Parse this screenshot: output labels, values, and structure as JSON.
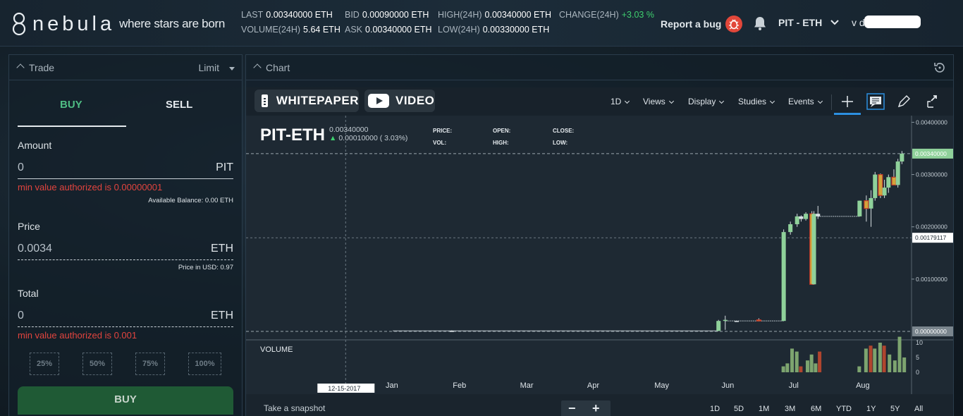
{
  "header": {
    "logo_name": "nebula",
    "logo_tagline": "where stars are born",
    "stats": {
      "last_label": "LAST",
      "last_value": "0.00340000 ETH",
      "bid_label": "BID",
      "bid_value": "0.00090000 ETH",
      "high_label": "HIGH(24H)",
      "high_value": "0.00340000 ETH",
      "change_label": "CHANGE(24H)",
      "change_value": "+3.03 %",
      "volume_label": "VOLUME(24H)",
      "volume_value": "5.64 ETH",
      "ask_label": "ASK",
      "ask_value": "0.00340000 ETH",
      "low_label": "LOW(24H)",
      "low_value": "0.00330000 ETH"
    },
    "report_bug_label": "Report a bug",
    "pair": "PIT - ETH",
    "user_email": "v           da@gma"
  },
  "trade": {
    "title": "Trade",
    "order_type": "Limit",
    "buy_tab": "BUY",
    "sell_tab": "SELL",
    "amount_label": "Amount",
    "amount_value": "0",
    "amount_unit": "PIT",
    "amount_error": "min value authorized is 0.00000001",
    "available_balance": "Available Balance: 0.00 ETH",
    "price_label": "Price",
    "price_value": "0.0034",
    "price_unit": "ETH",
    "price_usd": "Price in USD: 0.97",
    "total_label": "Total",
    "total_value": "0",
    "total_unit": "ETH",
    "total_error": "min value authorized is 0.001",
    "percent_buttons": [
      "25%",
      "50%",
      "75%",
      "100%"
    ],
    "buy_button": "BUY"
  },
  "chart": {
    "title": "Chart",
    "whitepaper": "WHITEPAPER",
    "video": "VIDEO",
    "toolbar": [
      "1D",
      "Views",
      "Display",
      "Studies",
      "Events"
    ],
    "pair": "PIT-ETH",
    "last_price": "0.00340000",
    "change": "0.00010000 ( 3.03%)",
    "ohlc_labels": [
      "PRICE:",
      "OPEN:",
      "CLOSE:",
      "VOL:",
      "HIGH:",
      "LOW:"
    ],
    "volume_label": "VOLUME",
    "snapshot_label": "Take a snapshot",
    "zoom_out": "−",
    "zoom_in": "+",
    "ranges": [
      "1D",
      "5D",
      "1M",
      "3M",
      "6M",
      "YTD",
      "1Y",
      "5Y",
      "All"
    ],
    "crosshair_date": "12-15-2017",
    "crosshair_price": "0.00179117",
    "current_price_tag": "0.00340000",
    "zero_price_tag": "0.00000000"
  },
  "chart_data": {
    "type": "candlestick",
    "x_axis_labels": [
      "Jan",
      "Feb",
      "Mar",
      "Apr",
      "May",
      "Jun",
      "Jul",
      "Aug"
    ],
    "price_axis": {
      "ticks": [
        "0.00400000",
        "0.00300000",
        "0.00200000",
        "0.00100000"
      ],
      "ylim": [
        0,
        0.0041
      ]
    },
    "volume_axis": {
      "ticks": [
        "10",
        "5",
        "0"
      ],
      "ylim": [
        0,
        10
      ]
    },
    "colors": {
      "up": "#8fd19a",
      "down": "#c0392b",
      "down_fill": "#d4a43a"
    },
    "candles": [
      {
        "t": 0.88,
        "o": 1e-05,
        "h": 2e-05,
        "l": 0.0,
        "c": 1e-05,
        "dir": "flat"
      },
      {
        "t": 4.85,
        "o": 1e-05,
        "h": 0.00022,
        "l": 1e-05,
        "c": 0.0002,
        "dir": "up"
      },
      {
        "t": 4.95,
        "o": 0.0002,
        "h": 0.0003,
        "l": 3e-05,
        "c": 0.00022,
        "dir": "up"
      },
      {
        "t": 5.12,
        "o": 0.0002,
        "h": 0.0002,
        "l": 0.0002,
        "c": 0.0002,
        "dir": "flat"
      },
      {
        "t": 5.45,
        "o": 0.00022,
        "h": 0.00025,
        "l": 0.00019,
        "c": 0.0002,
        "dir": "down"
      },
      {
        "t": 5.82,
        "o": 0.0002,
        "h": 0.00195,
        "l": 0.0002,
        "c": 0.0019,
        "dir": "up"
      },
      {
        "t": 5.92,
        "o": 0.0019,
        "h": 0.0021,
        "l": 0.00185,
        "c": 0.00205,
        "dir": "up"
      },
      {
        "t": 6.02,
        "o": 0.00205,
        "h": 0.00225,
        "l": 0.002,
        "c": 0.0022,
        "dir": "up"
      },
      {
        "t": 6.08,
        "o": 0.0022,
        "h": 0.00222,
        "l": 0.0021,
        "c": 0.00215,
        "dir": "flat"
      },
      {
        "t": 6.15,
        "o": 0.00215,
        "h": 0.00228,
        "l": 0.00212,
        "c": 0.00225,
        "dir": "up"
      },
      {
        "t": 6.24,
        "o": 0.00225,
        "h": 0.0023,
        "l": 0.0009,
        "c": 0.0009,
        "dir": "down"
      },
      {
        "t": 6.27,
        "o": 0.0009,
        "h": 0.0023,
        "l": 0.0009,
        "c": 0.00225,
        "dir": "up"
      },
      {
        "t": 6.33,
        "o": 0.00225,
        "h": 0.0024,
        "l": 0.00215,
        "c": 0.0022,
        "dir": "flat"
      },
      {
        "t": 6.95,
        "o": 0.0022,
        "h": 0.0025,
        "l": 0.0022,
        "c": 0.0025,
        "dir": "up"
      },
      {
        "t": 7.05,
        "o": 0.0025,
        "h": 0.0026,
        "l": 0.0021,
        "c": 0.00235,
        "dir": "down"
      },
      {
        "t": 7.12,
        "o": 0.00235,
        "h": 0.0027,
        "l": 0.002,
        "c": 0.00255,
        "dir": "up"
      },
      {
        "t": 7.18,
        "o": 0.00255,
        "h": 0.00305,
        "l": 0.0025,
        "c": 0.003,
        "dir": "up"
      },
      {
        "t": 7.26,
        "o": 0.003,
        "h": 0.00302,
        "l": 0.00255,
        "c": 0.0026,
        "dir": "down"
      },
      {
        "t": 7.32,
        "o": 0.0026,
        "h": 0.0029,
        "l": 0.00255,
        "c": 0.00275,
        "dir": "up"
      },
      {
        "t": 7.38,
        "o": 0.00275,
        "h": 0.003,
        "l": 0.00265,
        "c": 0.00295,
        "dir": "up"
      },
      {
        "t": 7.46,
        "o": 0.00295,
        "h": 0.0031,
        "l": 0.0028,
        "c": 0.0028,
        "dir": "down"
      },
      {
        "t": 7.52,
        "o": 0.0028,
        "h": 0.0033,
        "l": 0.00275,
        "c": 0.00325,
        "dir": "up"
      },
      {
        "t": 7.58,
        "o": 0.00325,
        "h": 0.00345,
        "l": 0.0032,
        "c": 0.0034,
        "dir": "up"
      }
    ],
    "volumes": [
      {
        "t": 5.82,
        "v": 2,
        "dir": "up"
      },
      {
        "t": 5.88,
        "v": 3,
        "dir": "up"
      },
      {
        "t": 5.95,
        "v": 8,
        "dir": "up"
      },
      {
        "t": 6.02,
        "v": 7,
        "dir": "up"
      },
      {
        "t": 6.08,
        "v": 2,
        "dir": "down"
      },
      {
        "t": 6.18,
        "v": 4,
        "dir": "up"
      },
      {
        "t": 6.24,
        "v": 6,
        "dir": "up"
      },
      {
        "t": 6.3,
        "v": 3,
        "dir": "up"
      },
      {
        "t": 6.36,
        "v": 7,
        "dir": "down"
      },
      {
        "t": 6.95,
        "v": 2,
        "dir": "up"
      },
      {
        "t": 7.05,
        "v": 8,
        "dir": "up"
      },
      {
        "t": 7.12,
        "v": 9,
        "dir": "down"
      },
      {
        "t": 7.18,
        "v": 8,
        "dir": "up"
      },
      {
        "t": 7.26,
        "v": 10,
        "dir": "up"
      },
      {
        "t": 7.32,
        "v": 9,
        "dir": "down"
      },
      {
        "t": 7.4,
        "v": 6,
        "dir": "up"
      },
      {
        "t": 7.48,
        "v": 4,
        "dir": "up"
      },
      {
        "t": 7.55,
        "v": 12,
        "dir": "up"
      },
      {
        "t": 7.62,
        "v": 5,
        "dir": "up"
      }
    ],
    "crosshair": {
      "t": -0.7,
      "price": 0.00179117
    },
    "current_price": 0.0034
  }
}
